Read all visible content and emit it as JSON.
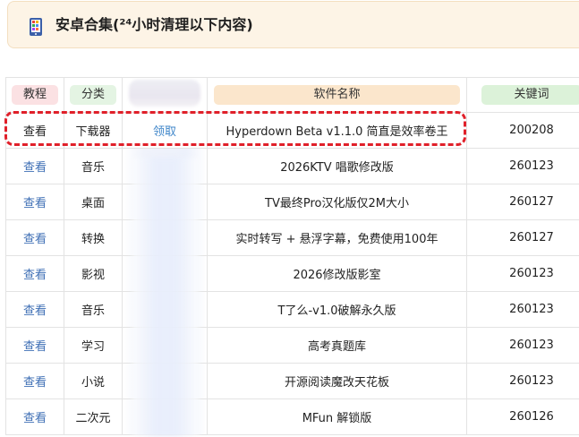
{
  "header": {
    "title": "安卓合集(²⁴小时清理以下内容)",
    "icon": "phone-icon"
  },
  "table": {
    "columns": [
      "教程",
      "分类",
      "",
      "软件名称",
      "关键词"
    ],
    "rows": [
      {
        "tutorial": "查看",
        "category": "下载器",
        "action": "领取",
        "name": "Hyperdown Beta v1.1.0 简直是效率卷王",
        "keyword": "200208"
      },
      {
        "tutorial": "查看",
        "category": "音乐",
        "action": "",
        "name": "2026KTV 唱歌修改版",
        "keyword": "260123"
      },
      {
        "tutorial": "查看",
        "category": "桌面",
        "action": "",
        "name": "TV最终Pro汉化版仅2M大小",
        "keyword": "260127"
      },
      {
        "tutorial": "查看",
        "category": "转换",
        "action": "",
        "name": "实时转写 + 悬浮字幕，免费使用100年",
        "keyword": "260127"
      },
      {
        "tutorial": "查看",
        "category": "影视",
        "action": "",
        "name": "2026修改版影室",
        "keyword": "260123"
      },
      {
        "tutorial": "查看",
        "category": "音乐",
        "action": "",
        "name": "T了么-v1.0破解永久版",
        "keyword": "260123"
      },
      {
        "tutorial": "查看",
        "category": "学习",
        "action": "",
        "name": "高考真题库",
        "keyword": "260123"
      },
      {
        "tutorial": "查看",
        "category": "小说",
        "action": "",
        "name": "开源阅读魔改天花板",
        "keyword": "260123"
      },
      {
        "tutorial": "查看",
        "category": "二次元",
        "action": "",
        "name": "MFun 解锁版",
        "keyword": "260126"
      }
    ]
  },
  "colors": {
    "link": "#3f6fb5",
    "highlight": "#e0202a",
    "header_bg": "#fdf4e6"
  }
}
